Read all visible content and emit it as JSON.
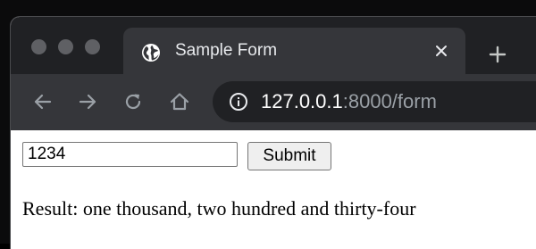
{
  "browser": {
    "tab": {
      "title": "Sample Form",
      "icon": "globe-icon"
    },
    "address_bar": {
      "host": "127.0.0.1",
      "path": ":8000/form",
      "icon": "info-icon"
    },
    "nav_icons": [
      "back-icon",
      "forward-icon",
      "reload-icon",
      "home-icon"
    ],
    "colors": {
      "tabstrip": "#202124",
      "toolbar": "#35363a",
      "omnibox": "#202124"
    }
  },
  "form": {
    "input_value": "1234",
    "submit_label": "Submit",
    "result_text": "Result: one thousand, two hundred and thirty-four"
  }
}
